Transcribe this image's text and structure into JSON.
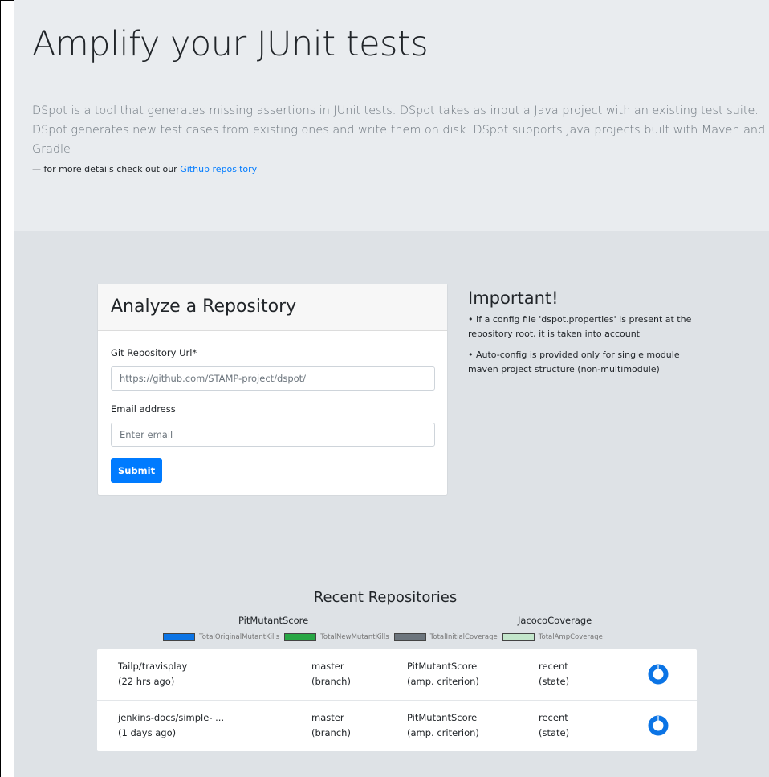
{
  "hero": {
    "title": "Amplify your JUnit tests",
    "lead": "DSpot is a tool that generates missing assertions in JUnit tests. DSpot takes as input a Java project with an existing test suite. DSpot generates new test cases from existing ones and write them on disk. DSpot supports Java projects built with Maven and Gradle",
    "details_prefix": "— for more details check out our",
    "details_link": "Github repository"
  },
  "form": {
    "title": "Analyze a Repository",
    "url_label": "Git Repository Url*",
    "url_placeholder": "https://github.com/STAMP-project/dspot/",
    "email_label": "Email address",
    "email_placeholder": "Enter email",
    "submit_label": "Submit"
  },
  "important": {
    "title": "Important!",
    "note1": "• If a config file 'dspot.properties' is present at the repository root, it is taken into account",
    "note2": "• Auto-config is provided only for single module maven project structure (non-multimodule)"
  },
  "recent": {
    "title": "Recent Repositories",
    "legend_group1": "PitMutantScore",
    "legend_group2": "JacocoCoverage",
    "legend": [
      {
        "label": "TotalOriginalMutantKills",
        "color": "#0b74e5"
      },
      {
        "label": "TotalNewMutantKills",
        "color": "#28a745"
      },
      {
        "label": "TotalInitialCoverage",
        "color": "#6c757d"
      },
      {
        "label": "TotalAmpCoverage",
        "color": "#c3e6cb"
      }
    ],
    "repos": [
      {
        "name": "Tailp/travisplay",
        "age": "(22 hrs ago)",
        "branch": "master",
        "branch_label": "(branch)",
        "criterion": "PitMutantScore",
        "criterion_label": "(amp. criterion)",
        "state": "recent",
        "state_label": "(state)"
      },
      {
        "name": "jenkins-docs/simple- ...",
        "age": "(1 days ago)",
        "branch": "master",
        "branch_label": "(branch)",
        "criterion": "PitMutantScore",
        "criterion_label": "(amp. criterion)",
        "state": "recent",
        "state_label": "(state)"
      }
    ]
  },
  "colors": {
    "primary": "#007bff",
    "hero_bg": "#e9ecef",
    "main_bg": "#dee2e6",
    "donut": "#0b74e5"
  },
  "icons": {
    "status": "loading-donut-icon"
  }
}
